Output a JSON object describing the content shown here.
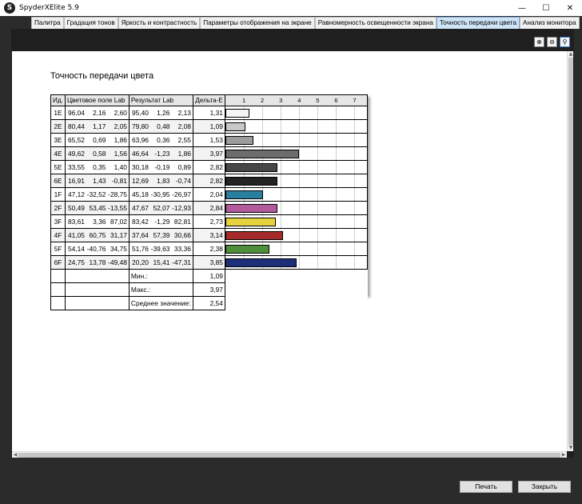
{
  "window": {
    "title": "SpyderXElite 5.9",
    "icon_letter": "S"
  },
  "tabs": [
    {
      "label": "Палитра",
      "active": false
    },
    {
      "label": "Градация тонов",
      "active": false
    },
    {
      "label": "Яркость и контрастность",
      "active": false
    },
    {
      "label": "Параметры отображения на экране",
      "active": false
    },
    {
      "label": "Равномерность освещенности экрана",
      "active": false
    },
    {
      "label": "Точность передачи цвета",
      "active": true
    },
    {
      "label": "Анализ монитора",
      "active": false
    }
  ],
  "zoom": {
    "in_icon": "zoom-in-icon",
    "out_icon": "zoom-out-icon",
    "fit_icon": "zoom-fit-icon"
  },
  "report": {
    "title": "Точность передачи цвета",
    "headers": {
      "id": "Ид.",
      "target": "Цветовое поле Lab",
      "result": "Результат Lab",
      "delta": "Дельта-E"
    },
    "scale_ticks": [
      "1",
      "2",
      "3",
      "4",
      "5",
      "6",
      "7"
    ],
    "scale_max": 7.8,
    "rows": [
      {
        "id": "1E",
        "target": [
          "96,04",
          "2,16",
          "2,60"
        ],
        "result": [
          "95,40",
          "1,26",
          "2,13"
        ],
        "delta": "1,31",
        "value": 1.31,
        "color": "#f4f4f4"
      },
      {
        "id": "2E",
        "target": [
          "80,44",
          "1,17",
          "2,05"
        ],
        "result": [
          "79,80",
          "0,48",
          "2,08"
        ],
        "delta": "1,09",
        "value": 1.09,
        "color": "#c8c8c8"
      },
      {
        "id": "3E",
        "target": [
          "65,52",
          "0,69",
          "1,86"
        ],
        "result": [
          "63,96",
          "0,36",
          "2,55"
        ],
        "delta": "1,53",
        "value": 1.53,
        "color": "#9c9c9c"
      },
      {
        "id": "4E",
        "target": [
          "49,62",
          "0,58",
          "1,56"
        ],
        "result": [
          "46,64",
          "-1,23",
          "1,86"
        ],
        "delta": "3,97",
        "value": 3.97,
        "color": "#6c6c6c"
      },
      {
        "id": "5E",
        "target": [
          "33,55",
          "0,35",
          "1,40"
        ],
        "result": [
          "30,18",
          "-0,19",
          "0,89"
        ],
        "delta": "2,82",
        "value": 2.82,
        "color": "#474747"
      },
      {
        "id": "6E",
        "target": [
          "16,91",
          "1,43",
          "-0,81"
        ],
        "result": [
          "12,69",
          "1,83",
          "-0,74"
        ],
        "delta": "2,82",
        "value": 2.82,
        "color": "#232323"
      },
      {
        "id": "1F",
        "target": [
          "47,12",
          "-32,52",
          "-28,75"
        ],
        "result": [
          "45,18",
          "-30,95",
          "-26,97"
        ],
        "delta": "2,04",
        "value": 2.04,
        "color": "#2a7f9e"
      },
      {
        "id": "2F",
        "target": [
          "50,49",
          "53,45",
          "-13,55"
        ],
        "result": [
          "47,67",
          "52,07",
          "-12,93"
        ],
        "delta": "2,84",
        "value": 2.84,
        "color": "#b25a9c"
      },
      {
        "id": "3F",
        "target": [
          "83,61",
          "3,36",
          "87,02"
        ],
        "result": [
          "83,42",
          "-1,29",
          "82,81"
        ],
        "delta": "2,73",
        "value": 2.73,
        "color": "#e6d23c"
      },
      {
        "id": "4F",
        "target": [
          "41,05",
          "60,75",
          "31,17"
        ],
        "result": [
          "37,64",
          "57,39",
          "30,66"
        ],
        "delta": "3,14",
        "value": 3.14,
        "color": "#a52a2a"
      },
      {
        "id": "5F",
        "target": [
          "54,14",
          "-40,76",
          "34,75"
        ],
        "result": [
          "51,76",
          "-39,63",
          "33,36"
        ],
        "delta": "2,38",
        "value": 2.38,
        "color": "#4f8f3c"
      },
      {
        "id": "6F",
        "target": [
          "24,75",
          "13,78",
          "-49,48"
        ],
        "result": [
          "20,20",
          "15,41",
          "-47,31"
        ],
        "delta": "3,85",
        "value": 3.85,
        "color": "#1e2f7a"
      }
    ],
    "summary": [
      {
        "label": "Мин.:",
        "value": "1,09"
      },
      {
        "label": "Макс.:",
        "value": "3,97"
      },
      {
        "label": "Среднее значение:",
        "value": "2,54"
      }
    ]
  },
  "buttons": {
    "print": "Печать",
    "close": "Закрыть"
  }
}
